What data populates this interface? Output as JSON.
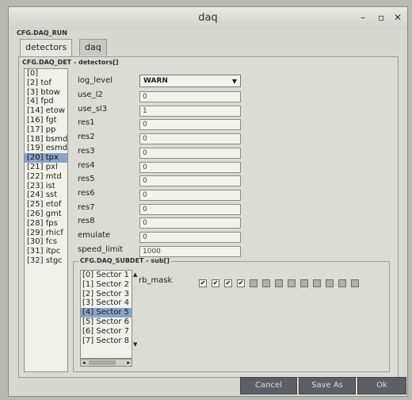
{
  "window": {
    "title": "daq"
  },
  "groups": {
    "run_legend": "CFG.DAQ_RUN",
    "det_legend": "CFG.DAQ_DET - detectors[]",
    "sub_legend": "CFG.DAQ_SUBDET - sub[]"
  },
  "tabs": [
    {
      "label": "detectors",
      "active": true
    },
    {
      "label": "daq",
      "active": false
    }
  ],
  "detectors": [
    "[0]",
    "[2] tof",
    "[3] btow",
    "[4] fpd",
    "[14] etow",
    "[16] fgt",
    "[17] pp",
    "[18] bsmd",
    "[19] esmd",
    "[20] tpx",
    "[21] pxl",
    "[22] mtd",
    "[23] ist",
    "[24] sst",
    "[25] etof",
    "[26] gmt",
    "[28] fps",
    "[29] rhicf",
    "[30] fcs",
    "[31] itpc",
    "[32] stgc"
  ],
  "selected_detector": "[20] tpx",
  "properties": {
    "log_level": {
      "label": "log_level",
      "value": "WARN"
    },
    "rows": [
      {
        "label": "use_l2",
        "value": "0"
      },
      {
        "label": "use_sl3",
        "value": "1"
      },
      {
        "label": "res1",
        "value": "0"
      },
      {
        "label": "res2",
        "value": "0"
      },
      {
        "label": "res3",
        "value": "0"
      },
      {
        "label": "res4",
        "value": "0"
      },
      {
        "label": "res5",
        "value": "0"
      },
      {
        "label": "res6",
        "value": "0"
      },
      {
        "label": "res7",
        "value": "0"
      },
      {
        "label": "res8",
        "value": "0"
      },
      {
        "label": "emulate",
        "value": "0"
      },
      {
        "label": "speed_limit",
        "value": "1000"
      }
    ]
  },
  "sectors": [
    "[0] Sector 1",
    "[1] Sector 2",
    "[2] Sector 3",
    "[3] Sector 4",
    "[4] Sector 5",
    "[5] Sector 6",
    "[6] Sector 7",
    "[7] Sector 8"
  ],
  "selected_sector": "[4] Sector 5",
  "rb_mask": {
    "label": "rb_mask",
    "checked": [
      true,
      true,
      true,
      true,
      false,
      false,
      false,
      false,
      false,
      false,
      false,
      false,
      false
    ]
  },
  "buttons": {
    "cancel": "Cancel",
    "save_as": "Save As",
    "ok": "Ok"
  }
}
